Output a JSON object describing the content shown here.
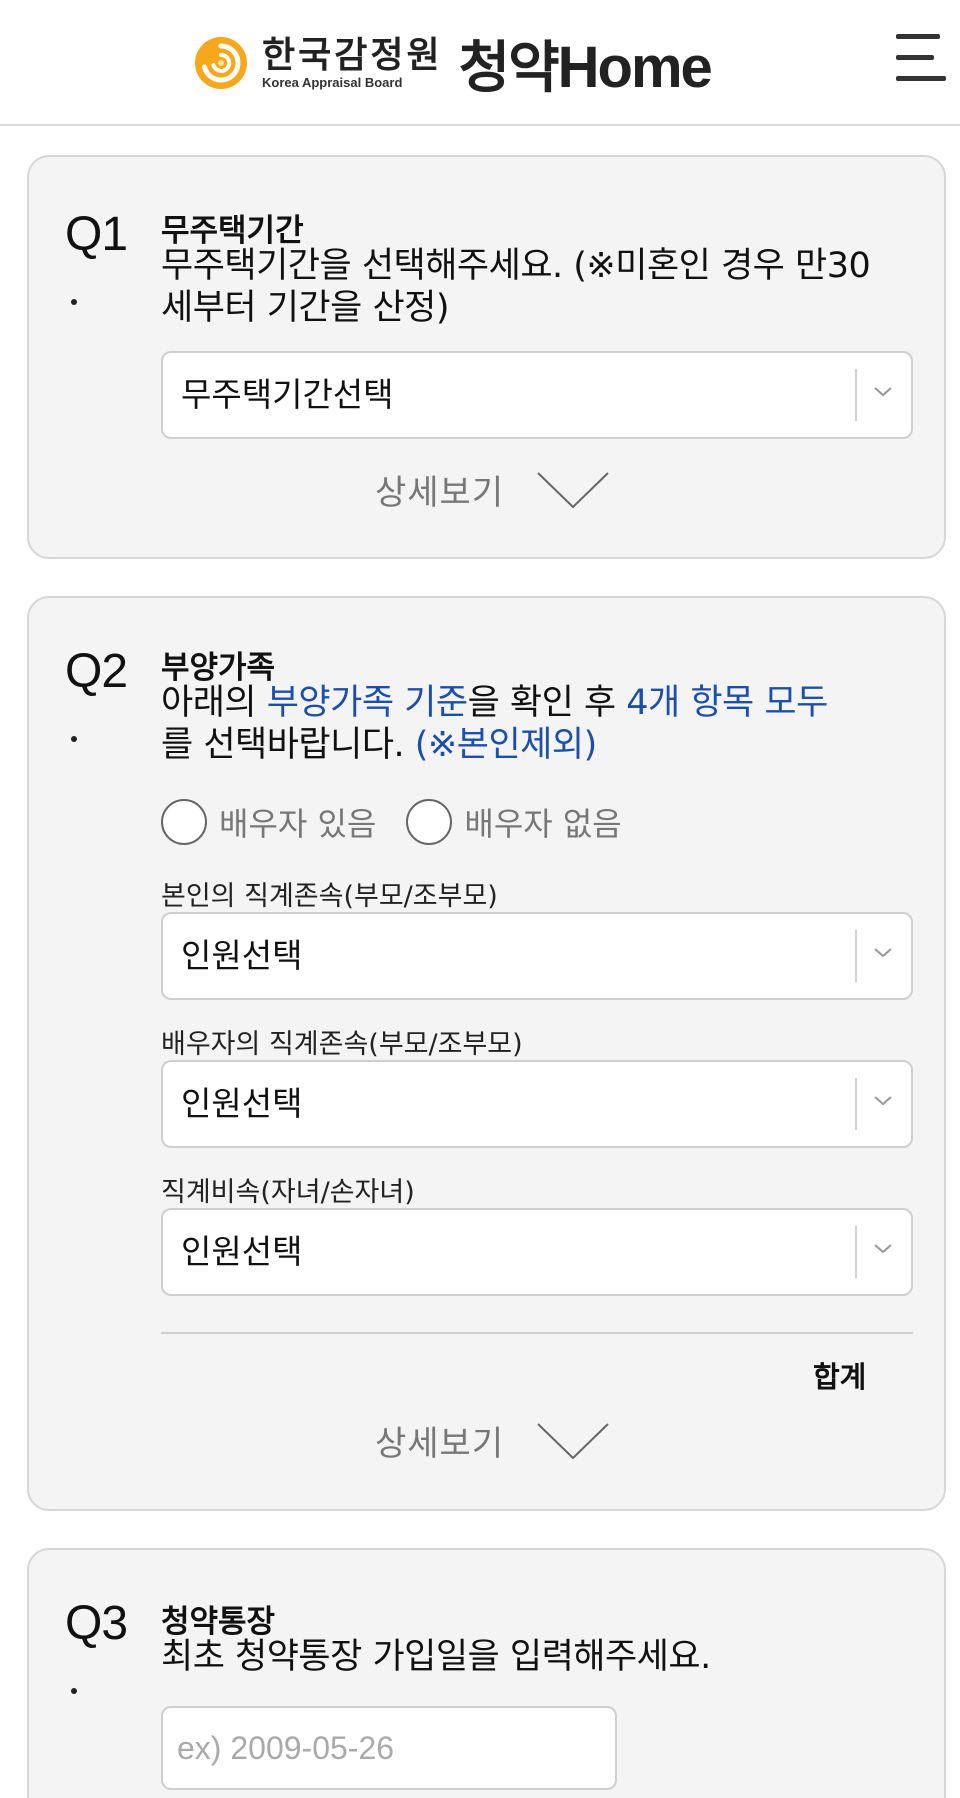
{
  "header": {
    "org_ko": "한국감정원",
    "org_en": "Korea Appraisal Board",
    "brand_ko": "청약",
    "brand_en": "Home",
    "logo_colors": {
      "outer": "#f6a81c",
      "inner": "#f8c64a"
    }
  },
  "q1": {
    "number": "Q1",
    "dot": ".",
    "title": "무주택기간",
    "description": "무주택기간을 선택해주세요. (※미혼인 경우 만30세부터 기간을 산정)",
    "select_value": "무주택기간선택",
    "detail_label": "상세보기"
  },
  "q2": {
    "number": "Q2",
    "dot": ".",
    "title": "부양가족",
    "desc_parts": {
      "p1": "아래의 ",
      "p2": "부양가족 기준",
      "p3": "을 확인 후 ",
      "p4": "4개 항목 모두",
      "p5": "를 선택바랍니다. ",
      "p6": "(※본인제외)"
    },
    "radio_spouse_yes": "배우자 있음",
    "radio_spouse_no": "배우자 없음",
    "field1_label": "본인의 직계존속(부모/조부모)",
    "field1_value": "인원선택",
    "field2_label": "배우자의 직계존속(부모/조부모)",
    "field2_value": "인원선택",
    "field3_label": "직계비속(자녀/손자녀)",
    "field3_value": "인원선택",
    "total_label": "합계",
    "detail_label": "상세보기"
  },
  "q3": {
    "number": "Q3",
    "dot": ".",
    "title": "청약통장",
    "description": "최초 청약통장 가입일을 입력해주세요.",
    "date_placeholder": "ex) 2009-05-26"
  },
  "colors": {
    "accent_blue": "#1e4fa8",
    "card_bg": "#f4f4f4",
    "muted_text": "#777777"
  }
}
